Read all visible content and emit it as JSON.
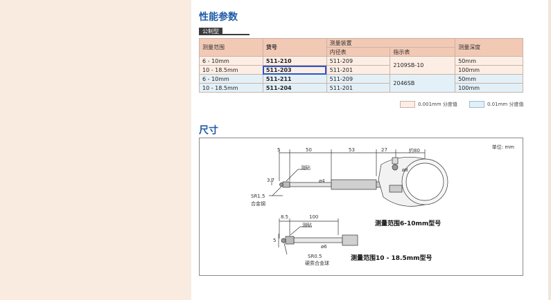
{
  "section_title": "性能参数",
  "type_tag": "公制型",
  "table": {
    "headers": {
      "range": "测量范围",
      "code": "货号",
      "device": "测量装置",
      "inner": "内径表",
      "indicator": "指示表",
      "depth": "测量深度"
    },
    "rows": [
      {
        "range": "6 - 10mm",
        "code": "511-210",
        "inner": "511-209",
        "indicator": "2109SB-10",
        "depth": "50mm"
      },
      {
        "range": "10 - 18.5mm",
        "code": "511-203",
        "inner": "511-201",
        "indicator": "",
        "depth": "100mm"
      },
      {
        "range": "6 - 10mm",
        "code": "511-211",
        "inner": "511-209",
        "indicator": "2046SB",
        "depth": "50mm"
      },
      {
        "range": "10 - 18.5mm",
        "code": "511-204",
        "inner": "511-201",
        "indicator": "",
        "depth": "100mm"
      }
    ]
  },
  "legend": {
    "pink_label": "0.001mm 分度值",
    "blue_label": "0.01mm 分度值",
    "pink_color": "#fdeee5",
    "blue_color": "#e3f0f8"
  },
  "dim_title": "尺寸",
  "diagram": {
    "unit": "单位: mm",
    "top_dims": [
      "5",
      "50",
      "53",
      "27",
      "约80"
    ],
    "dia_phi4": "ø4",
    "dia_phi8": "ø8",
    "h_37": "3.7",
    "anvil_label_1": "测砧",
    "sr15": "SR1.5",
    "alloy_steel": "合金钢",
    "caption_1": "测量范围6-10mm型号",
    "dim_85": "8.5",
    "dim_100": "100",
    "anvil_label_2": "测砧",
    "dim_5": "5",
    "dia_phi6": "ø6",
    "sr05": "SR0.5",
    "carbide_ball": "硬质合金球",
    "caption_2": "测量范围10 - 18.5mm型号"
  }
}
